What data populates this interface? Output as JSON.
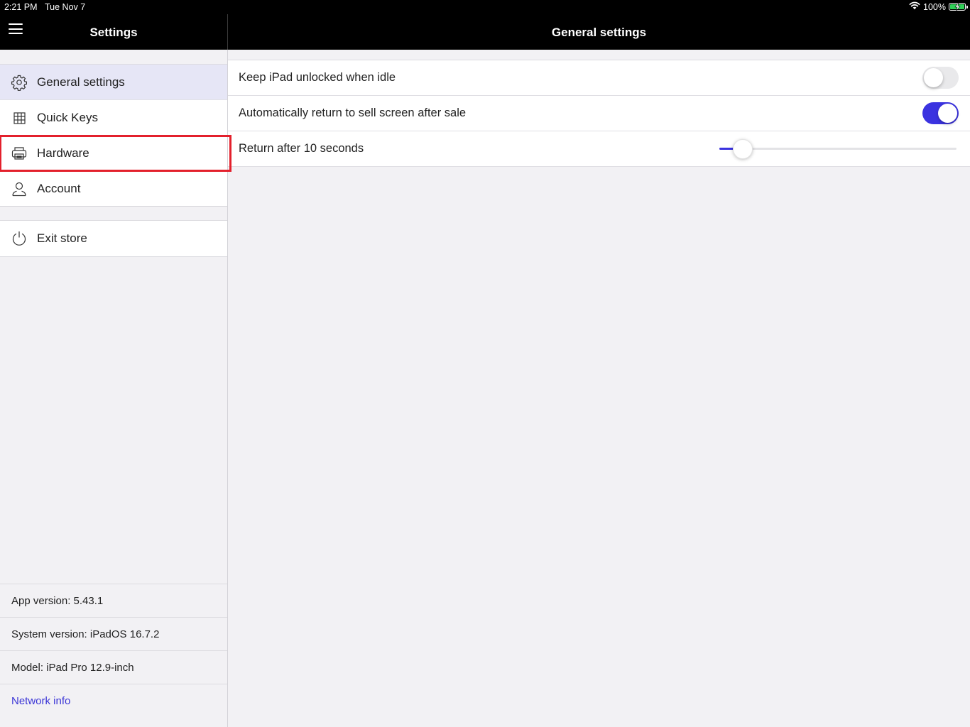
{
  "status_bar": {
    "time": "2:21 PM",
    "date": "Tue Nov 7",
    "battery_label": "100%",
    "wifi_icon": "wifi-icon",
    "battery_icon": "battery-charging-icon",
    "battery_color": "#31d158"
  },
  "sidebar": {
    "title": "Settings",
    "menu_icon": "hamburger-menu-icon",
    "items": [
      {
        "label": "General settings",
        "icon": "gear-icon",
        "selected": true
      },
      {
        "label": "Quick Keys",
        "icon": "grid-icon"
      },
      {
        "label": "Hardware",
        "icon": "printer-icon",
        "highlighted": true
      },
      {
        "label": "Account",
        "icon": "user-icon"
      }
    ],
    "exit": {
      "label": "Exit store",
      "icon": "power-icon"
    },
    "info": {
      "app_version": "App version: 5.43.1",
      "system_version": "System version: iPadOS 16.7.2",
      "model": "Model: iPad Pro 12.9-inch",
      "network_info": "Network info"
    }
  },
  "main": {
    "title": "General settings",
    "settings": {
      "keep_unlocked": {
        "label": "Keep iPad unlocked when idle",
        "enabled": false
      },
      "auto_return": {
        "label": "Automatically return to sell screen after sale",
        "enabled": true
      },
      "return_after": {
        "label": "Return after 10 seconds",
        "slider_fraction": 0.1
      }
    }
  },
  "colors": {
    "accent": "#3b33e0",
    "selected_bg": "#e6e6f6",
    "highlight_border": "#e3202c",
    "link": "#3b35d6"
  }
}
